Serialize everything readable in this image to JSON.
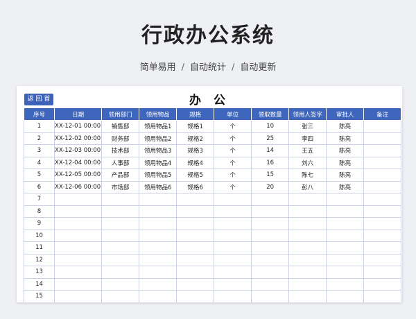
{
  "hero": {
    "title": "行政办公系统",
    "tagline": [
      "简单易用",
      "自动统计",
      "自动更新"
    ],
    "separator": "/"
  },
  "sheet": {
    "back_label": "返 回 首",
    "title": "办 公"
  },
  "table": {
    "headers": [
      "序号",
      "日期",
      "领用部门",
      "领用物品",
      "规格",
      "单位",
      "领取数量",
      "领用人签字",
      "审批人",
      "备注"
    ],
    "rows": [
      [
        "1",
        "XX-12-01 00:00",
        "销售部",
        "领用物品1",
        "规格1",
        "个",
        "10",
        "张三",
        "陈亮",
        ""
      ],
      [
        "2",
        "XX-12-02 00:00",
        "财务部",
        "领用物品2",
        "规格2",
        "个",
        "25",
        "李四",
        "陈亮",
        ""
      ],
      [
        "3",
        "XX-12-03 00:00",
        "技术部",
        "领用物品3",
        "规格3",
        "个",
        "14",
        "王五",
        "陈亮",
        ""
      ],
      [
        "4",
        "XX-12-04 00:00",
        "人事部",
        "领用物品4",
        "规格4",
        "个",
        "16",
        "刘六",
        "陈亮",
        ""
      ],
      [
        "5",
        "XX-12-05 00:00",
        "产品部",
        "领用物品5",
        "规格5",
        "个",
        "15",
        "陈七",
        "陈亮",
        ""
      ],
      [
        "6",
        "XX-12-06 00:00",
        "市场部",
        "领用物品6",
        "规格6",
        "个",
        "20",
        "彭八",
        "陈亮",
        ""
      ],
      [
        "7",
        "",
        "",
        "",
        "",
        "",
        "",
        "",
        "",
        ""
      ],
      [
        "8",
        "",
        "",
        "",
        "",
        "",
        "",
        "",
        "",
        ""
      ],
      [
        "9",
        "",
        "",
        "",
        "",
        "",
        "",
        "",
        "",
        ""
      ],
      [
        "10",
        "",
        "",
        "",
        "",
        "",
        "",
        "",
        "",
        ""
      ],
      [
        "11",
        "",
        "",
        "",
        "",
        "",
        "",
        "",
        "",
        ""
      ],
      [
        "12",
        "",
        "",
        "",
        "",
        "",
        "",
        "",
        "",
        ""
      ],
      [
        "13",
        "",
        "",
        "",
        "",
        "",
        "",
        "",
        "",
        ""
      ],
      [
        "14",
        "",
        "",
        "",
        "",
        "",
        "",
        "",
        "",
        ""
      ],
      [
        "15",
        "",
        "",
        "",
        "",
        "",
        "",
        "",
        "",
        ""
      ]
    ]
  },
  "colors": {
    "header_bg": "#3e66bd",
    "button_bg": "#3d63b9",
    "page_bg": "#eef0f4"
  }
}
